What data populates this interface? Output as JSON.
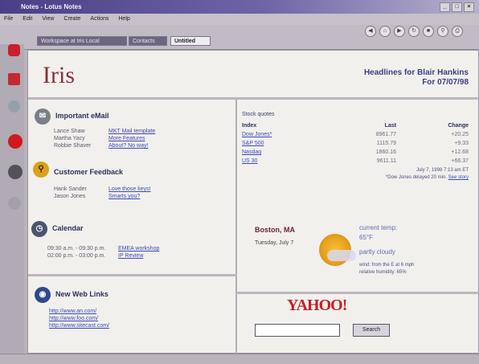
{
  "window": {
    "title": "Notes - Lotus Notes",
    "controls": [
      "_",
      "□",
      "×"
    ]
  },
  "menu": [
    "File",
    "Edit",
    "View",
    "Create",
    "Actions",
    "Help"
  ],
  "tabs": [
    "Workspace at Iris Local",
    "Contacts",
    "Untitled"
  ],
  "nav_icons": [
    "back-icon",
    "home-icon",
    "forward-icon",
    "refresh-icon",
    "stop-icon",
    "search-icon",
    "print-icon"
  ],
  "app": {
    "logo": "Iris",
    "headline_line1": "Headlines for Blair Hankins",
    "headline_line2": "For 07/07/98"
  },
  "email": {
    "title": "Important eMail",
    "items": [
      {
        "from": "Lance Shaw",
        "subject": "MKT Mail template"
      },
      {
        "from": "Martha Yacy",
        "subject": "More Features"
      },
      {
        "from": "Robbie Shaver",
        "subject": "About? No way!"
      }
    ]
  },
  "feedback": {
    "title": "Customer Feedback",
    "items": [
      {
        "from": "Hank Sander",
        "subject": "Love those keys!"
      },
      {
        "from": "Jason Jones",
        "subject": "Smarts you?"
      }
    ]
  },
  "calendar": {
    "title": "Calendar",
    "items": [
      {
        "time": "09:30 a.m. - 09:30 p.m.",
        "event": "EMEA workshop"
      },
      {
        "time": "02:00 p.m. - 03:00 p.m.",
        "event": "IP Review"
      }
    ]
  },
  "weblinks": {
    "title": "New Web Links",
    "items": [
      "http://www.an.com/",
      "http://www.foo.com/",
      "http://www.sitecast.com/"
    ]
  },
  "stocks": {
    "title": "Stock quotes",
    "headers": {
      "index": "Index",
      "last": "Last",
      "change": "Change"
    },
    "rows": [
      {
        "index": "Dow Jones*",
        "last": "8961.77",
        "change": "+20.25"
      },
      {
        "index": "S&P 500",
        "last": "1115.79",
        "change": "+9.33"
      },
      {
        "index": "Nasdaq",
        "last": "1860.16",
        "change": "+12.68"
      },
      {
        "index": "US 30",
        "last": "9611.11",
        "change": "+66.37"
      }
    ],
    "footnote1": "July 7, 1998 7:13 am ET",
    "footnote2_text": "*Dow Jones delayed 20 min.",
    "footnote2_link": "See story"
  },
  "weather": {
    "city": "Boston, MA",
    "date": "Tuesday, July 7",
    "current_label": "current temp:",
    "temp": "65°F",
    "condition": "partly cloudy",
    "wind": "wind: from the E at 6 mph",
    "humidity": "relative humidity: 65%"
  },
  "search": {
    "logo": "YAHOO!",
    "button": "Search",
    "placeholder": ""
  }
}
